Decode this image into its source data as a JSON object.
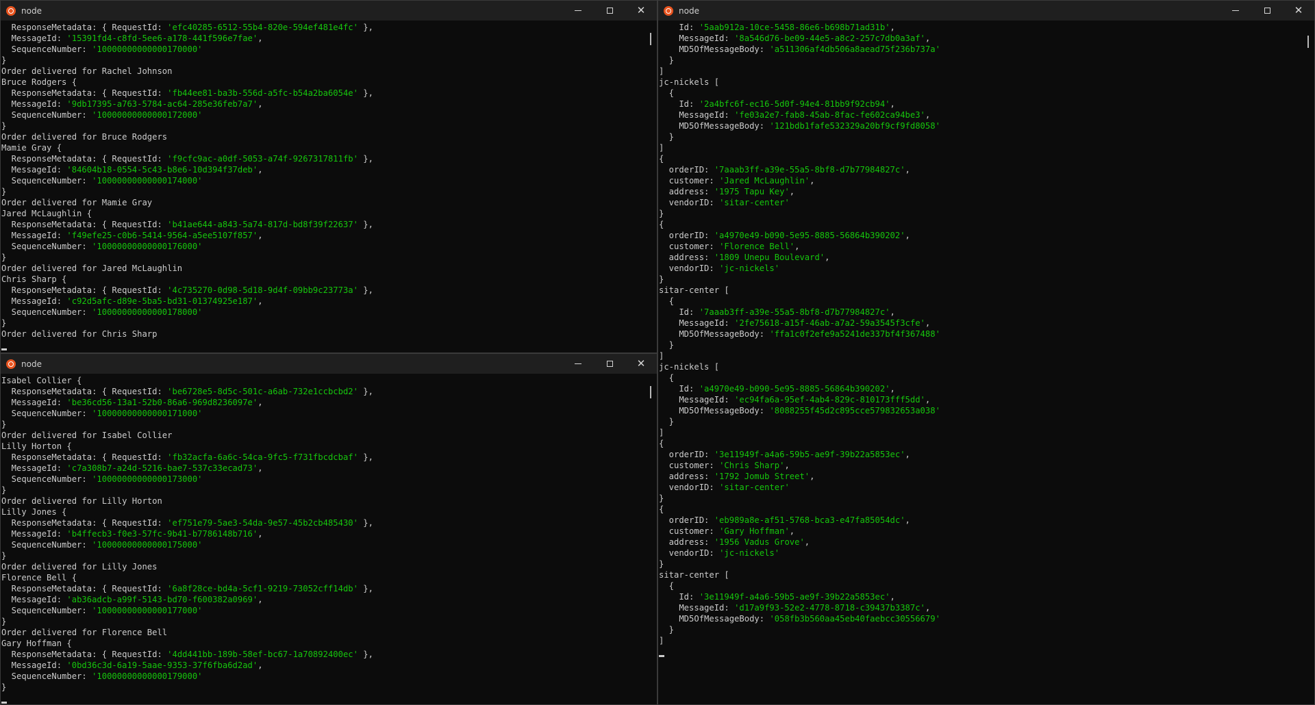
{
  "windows": [
    {
      "id": "top-left",
      "title": "node",
      "lines": [
        [
          "  ResponseMetadata: { RequestId: ",
          "'efc40285-6512-55b4-820e-594ef481e4fc'",
          " },"
        ],
        [
          "  MessageId: ",
          "'15391fd4-c8fd-5ee6-a178-441f596e7fae'",
          ","
        ],
        [
          "  SequenceNumber: ",
          "'10000000000000170000'",
          ""
        ],
        [
          "}"
        ],
        [
          "Order delivered for Rachel Johnson"
        ],
        [
          "Bruce Rodgers {"
        ],
        [
          "  ResponseMetadata: { RequestId: ",
          "'fb44ee81-ba3b-556d-a5fc-b54a2ba6054e'",
          " },"
        ],
        [
          "  MessageId: ",
          "'9db17395-a763-5784-ac64-285e36feb7a7'",
          ","
        ],
        [
          "  SequenceNumber: ",
          "'10000000000000172000'",
          ""
        ],
        [
          "}"
        ],
        [
          "Order delivered for Bruce Rodgers"
        ],
        [
          "Mamie Gray {"
        ],
        [
          "  ResponseMetadata: { RequestId: ",
          "'f9cfc9ac-a0df-5053-a74f-9267317811fb'",
          " },"
        ],
        [
          "  MessageId: ",
          "'84604b18-0554-5c43-b8e6-10d394f37deb'",
          ","
        ],
        [
          "  SequenceNumber: ",
          "'10000000000000174000'",
          ""
        ],
        [
          "}"
        ],
        [
          "Order delivered for Mamie Gray"
        ],
        [
          "Jared McLaughlin {"
        ],
        [
          "  ResponseMetadata: { RequestId: ",
          "'b41ae644-a843-5a74-817d-bd8f39f22637'",
          " },"
        ],
        [
          "  MessageId: ",
          "'f49efe25-c0b6-5414-9564-a5ee5107f857'",
          ","
        ],
        [
          "  SequenceNumber: ",
          "'10000000000000176000'",
          ""
        ],
        [
          "}"
        ],
        [
          "Order delivered for Jared McLaughlin"
        ],
        [
          "Chris Sharp {"
        ],
        [
          "  ResponseMetadata: { RequestId: ",
          "'4c735270-0d98-5d18-9d4f-09bb9c23773a'",
          " },"
        ],
        [
          "  MessageId: ",
          "'c92d5afc-d89e-5ba5-bd31-01374925e187'",
          ","
        ],
        [
          "  SequenceNumber: ",
          "'10000000000000178000'",
          ""
        ],
        [
          "}"
        ],
        [
          "Order delivered for Chris Sharp"
        ]
      ]
    },
    {
      "id": "bottom-left",
      "title": "node",
      "lines": [
        [
          "Isabel Collier {"
        ],
        [
          "  ResponseMetadata: { RequestId: ",
          "'be6728e5-8d5c-501c-a6ab-732e1ccbcbd2'",
          " },"
        ],
        [
          "  MessageId: ",
          "'be36cd56-13a1-52b0-86a6-969d8236097e'",
          ","
        ],
        [
          "  SequenceNumber: ",
          "'10000000000000171000'",
          ""
        ],
        [
          "}"
        ],
        [
          "Order delivered for Isabel Collier"
        ],
        [
          "Lilly Horton {"
        ],
        [
          "  ResponseMetadata: { RequestId: ",
          "'fb32acfa-6a6c-54ca-9fc5-f731fbcdcbaf'",
          " },"
        ],
        [
          "  MessageId: ",
          "'c7a308b7-a24d-5216-bae7-537c33ecad73'",
          ","
        ],
        [
          "  SequenceNumber: ",
          "'10000000000000173000'",
          ""
        ],
        [
          "}"
        ],
        [
          "Order delivered for Lilly Horton"
        ],
        [
          "Lilly Jones {"
        ],
        [
          "  ResponseMetadata: { RequestId: ",
          "'ef751e79-5ae3-54da-9e57-45b2cb485430'",
          " },"
        ],
        [
          "  MessageId: ",
          "'b4ffecb3-f0e3-57fc-9b41-b7786148b716'",
          ","
        ],
        [
          "  SequenceNumber: ",
          "'10000000000000175000'",
          ""
        ],
        [
          "}"
        ],
        [
          "Order delivered for Lilly Jones"
        ],
        [
          "Florence Bell {"
        ],
        [
          "  ResponseMetadata: { RequestId: ",
          "'6a8f28ce-bd4a-5cf1-9219-73052cff14db'",
          " },"
        ],
        [
          "  MessageId: ",
          "'ab36adcb-a99f-5143-bd70-f600382a0969'",
          ","
        ],
        [
          "  SequenceNumber: ",
          "'10000000000000177000'",
          ""
        ],
        [
          "}"
        ],
        [
          "Order delivered for Florence Bell"
        ],
        [
          "Gary Hoffman {"
        ],
        [
          "  ResponseMetadata: { RequestId: ",
          "'4dd441bb-189b-58ef-bc67-1a70892400ec'",
          " },"
        ],
        [
          "  MessageId: ",
          "'0bd36c3d-6a19-5aae-9353-37f6fba6d2ad'",
          ","
        ],
        [
          "  SequenceNumber: ",
          "'10000000000000179000'",
          ""
        ],
        [
          "}"
        ]
      ]
    },
    {
      "id": "right",
      "title": "node",
      "lines": [
        [
          "    Id: ",
          "'5aab912a-10ce-5458-86e6-b698b71ad31b'",
          ","
        ],
        [
          "    MessageId: ",
          "'8a546d76-be09-44e5-a8c2-257c7db0a3af'",
          ","
        ],
        [
          "    MD5OfMessageBody: ",
          "'a511306af4db506a8aead75f236b737a'",
          ""
        ],
        [
          "  }"
        ],
        [
          "]"
        ],
        [
          "jc-nickels ["
        ],
        [
          "  {"
        ],
        [
          "    Id: ",
          "'2a4bfc6f-ec16-5d0f-94e4-81bb9f92cb94'",
          ","
        ],
        [
          "    MessageId: ",
          "'fe03a2e7-fab8-45ab-8fac-fe602ca94be3'",
          ","
        ],
        [
          "    MD5OfMessageBody: ",
          "'121bdb1fafe532329a20bf9cf9fd8058'",
          ""
        ],
        [
          "  }"
        ],
        [
          "]"
        ],
        [
          "{"
        ],
        [
          "  orderID: ",
          "'7aaab3ff-a39e-55a5-8bf8-d7b77984827c'",
          ","
        ],
        [
          "  customer: ",
          "'Jared McLaughlin'",
          ","
        ],
        [
          "  address: ",
          "'1975 Tapu Key'",
          ","
        ],
        [
          "  vendorID: ",
          "'sitar-center'",
          ""
        ],
        [
          "}"
        ],
        [
          "{"
        ],
        [
          "  orderID: ",
          "'a4970e49-b090-5e95-8885-56864b390202'",
          ","
        ],
        [
          "  customer: ",
          "'Florence Bell'",
          ","
        ],
        [
          "  address: ",
          "'1809 Unepu Boulevard'",
          ","
        ],
        [
          "  vendorID: ",
          "'jc-nickels'",
          ""
        ],
        [
          "}"
        ],
        [
          "sitar-center ["
        ],
        [
          "  {"
        ],
        [
          "    Id: ",
          "'7aaab3ff-a39e-55a5-8bf8-d7b77984827c'",
          ","
        ],
        [
          "    MessageId: ",
          "'2fe75618-a15f-46ab-a7a2-59a3545f3cfe'",
          ","
        ],
        [
          "    MD5OfMessageBody: ",
          "'ffa1c0f2efe9a5241de337bf4f367488'",
          ""
        ],
        [
          "  }"
        ],
        [
          "]"
        ],
        [
          "jc-nickels ["
        ],
        [
          "  {"
        ],
        [
          "    Id: ",
          "'a4970e49-b090-5e95-8885-56864b390202'",
          ","
        ],
        [
          "    MessageId: ",
          "'ec94fa6a-95ef-4ab4-829c-810173fff5dd'",
          ","
        ],
        [
          "    MD5OfMessageBody: ",
          "'8088255f45d2c895cce579832653a038'",
          ""
        ],
        [
          "  }"
        ],
        [
          "]"
        ],
        [
          "{"
        ],
        [
          "  orderID: ",
          "'3e11949f-a4a6-59b5-ae9f-39b22a5853ec'",
          ","
        ],
        [
          "  customer: ",
          "'Chris Sharp'",
          ","
        ],
        [
          "  address: ",
          "'1792 Jomub Street'",
          ","
        ],
        [
          "  vendorID: ",
          "'sitar-center'",
          ""
        ],
        [
          "}"
        ],
        [
          "{"
        ],
        [
          "  orderID: ",
          "'eb989a8e-af51-5768-bca3-e47fa85054dc'",
          ","
        ],
        [
          "  customer: ",
          "'Gary Hoffman'",
          ","
        ],
        [
          "  address: ",
          "'1956 Vadus Grove'",
          ","
        ],
        [
          "  vendorID: ",
          "'jc-nickels'",
          ""
        ],
        [
          "}"
        ],
        [
          "sitar-center ["
        ],
        [
          "  {"
        ],
        [
          "    Id: ",
          "'3e11949f-a4a6-59b5-ae9f-39b22a5853ec'",
          ","
        ],
        [
          "    MessageId: ",
          "'d17a9f93-52e2-4778-8718-c39437b3387c'",
          ","
        ],
        [
          "    MD5OfMessageBody: ",
          "'058fb3b560aa45eb40faebcc30556679'",
          ""
        ],
        [
          "  }"
        ],
        [
          "]"
        ]
      ]
    }
  ],
  "colors": {
    "background": "#0c0c0c",
    "text": "#cccccc",
    "string": "#16c60c",
    "titlebar": "#1f1f1f",
    "app_icon": "#e9541f"
  },
  "icons": {
    "app": "ubuntu-icon",
    "minimize": "minimize-icon",
    "maximize": "maximize-icon",
    "close": "close-icon"
  }
}
